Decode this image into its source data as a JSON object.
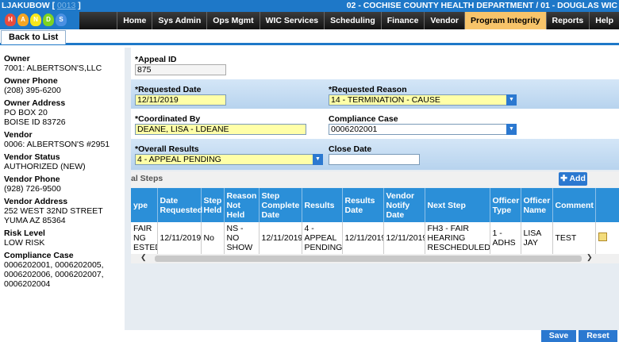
{
  "header": {
    "user": "LJAKUBOW",
    "user_code": "0013",
    "department": "02 - COCHISE COUNTY HEALTH DEPARTMENT / 01 - DOUGLAS WIC"
  },
  "logo": {
    "letters": [
      "H",
      "A",
      "N",
      "D",
      "S"
    ],
    "colors": [
      "#e94b3c",
      "#f5a623",
      "#f8e71c",
      "#7ed321",
      "#4a90e2"
    ]
  },
  "nav": {
    "items": [
      "Home",
      "Sys Admin",
      "Ops Mgmt",
      "WIC Services",
      "Scheduling",
      "Finance",
      "Vendor",
      "Program Integrity",
      "Reports",
      "Help"
    ],
    "active": "Program Integrity"
  },
  "subbar": {
    "back_label": "Back to List"
  },
  "vendor_info": [
    {
      "label": "Owner",
      "lines": [
        "7001: ALBERTSON'S,LLC"
      ]
    },
    {
      "label": "Owner Phone",
      "lines": [
        "(208) 395-6200"
      ]
    },
    {
      "label": "Owner Address",
      "lines": [
        "PO BOX 20",
        "BOISE ID 83726"
      ]
    },
    {
      "label": "Vendor",
      "lines": [
        "0006: ALBERTSON'S #2951"
      ]
    },
    {
      "label": "Vendor Status",
      "lines": [
        "AUTHORIZED (NEW)"
      ]
    },
    {
      "label": "Vendor Phone",
      "lines": [
        "(928) 726-9500"
      ]
    },
    {
      "label": "Vendor Address",
      "lines": [
        "252 WEST 32ND STREET",
        "YUMA AZ 85364"
      ]
    },
    {
      "label": "Risk Level",
      "lines": [
        "LOW RISK"
      ]
    },
    {
      "label": "Compliance Case",
      "lines": [
        "0006202001, 0006202005,",
        "0006202006, 0006202007,",
        "0006202004"
      ]
    }
  ],
  "form": {
    "appeal_id": {
      "label": "*Appeal ID",
      "value": "875"
    },
    "requested_date": {
      "label": "*Requested Date",
      "value": "12/11/2019"
    },
    "requested_reason": {
      "label": "*Requested Reason",
      "value": "14 - TERMINATION - CAUSE"
    },
    "coordinated_by": {
      "label": "*Coordinated By",
      "value": "DEANE, LISA  - LDEANE"
    },
    "compliance_case": {
      "label": "Compliance Case",
      "value": "0006202001"
    },
    "overall_results": {
      "label": "*Overall Results",
      "value": "4 - APPEAL PENDING"
    },
    "close_date": {
      "label": "Close Date",
      "value": ""
    }
  },
  "grid": {
    "title": "al Steps",
    "add_label": "Add",
    "columns": [
      "ype",
      "Date Requested",
      "Step Held",
      "Reason Not Held",
      "Step Complete Date",
      "Results",
      "Results Date",
      "Vendor Notify Date",
      "Next Step",
      "Officer Type",
      "Officer Name",
      "Comment",
      ""
    ],
    "rows": [
      [
        "FAIR NG ESTED",
        "12/11/2019",
        "No",
        "NS - NO SHOW",
        "12/11/2019",
        "4 - APPEAL PENDING",
        "12/11/2019",
        "12/11/2019",
        "FH3 - FAIR HEARING RESCHEDULED",
        "1 - ADHS",
        "LISA JAY",
        "TEST",
        ""
      ]
    ]
  },
  "footer": {
    "save_label": "Save",
    "reset_label": "Reset"
  }
}
